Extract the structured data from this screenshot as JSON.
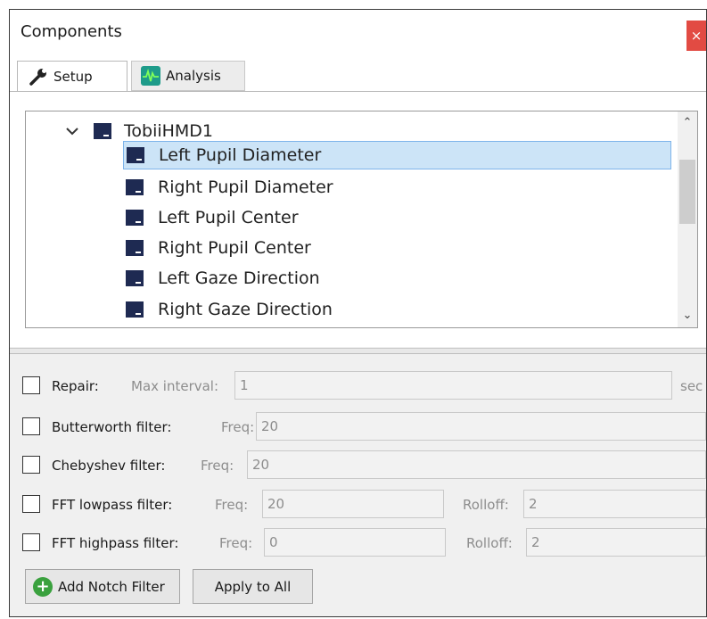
{
  "window": {
    "title": "Components",
    "close_label": "×"
  },
  "tabs": [
    {
      "label": "Setup",
      "icon": "wrench-icon"
    },
    {
      "label": "Analysis",
      "icon": "waveform-icon"
    }
  ],
  "tree": {
    "device": "TobiiHMD1",
    "items": [
      "Left Pupil Diameter",
      "Right Pupil Diameter",
      "Left Pupil Center",
      "Right Pupil Center",
      "Left Gaze Direction",
      "Right Gaze Direction"
    ],
    "selected_index": 0
  },
  "filters": {
    "repair": {
      "label": "Repair:",
      "sub_label": "Max interval:",
      "value": "1",
      "unit": "sec"
    },
    "butterworth": {
      "label": "Butterworth filter:",
      "sub_label": "Freq:",
      "value": "20"
    },
    "chebyshev": {
      "label": "Chebyshev filter:",
      "sub_label": "Freq:",
      "value": "20"
    },
    "fft_lowpass": {
      "label": "FFT lowpass filter:",
      "sub_label": "Freq:",
      "value": "20",
      "rolloff_label": "Rolloff:",
      "rolloff_value": "2"
    },
    "fft_highpass": {
      "label": "FFT highpass filter:",
      "sub_label": "Freq:",
      "value": "0",
      "rolloff_label": "Rolloff:",
      "rolloff_value": "2"
    }
  },
  "buttons": {
    "add_notch": "Add Notch Filter",
    "apply_all": "Apply to All"
  },
  "colors": {
    "selection": "#cce4f7",
    "close": "#e24b43",
    "device_icon": "#1e2a52",
    "add_icon": "#3aa13e"
  }
}
